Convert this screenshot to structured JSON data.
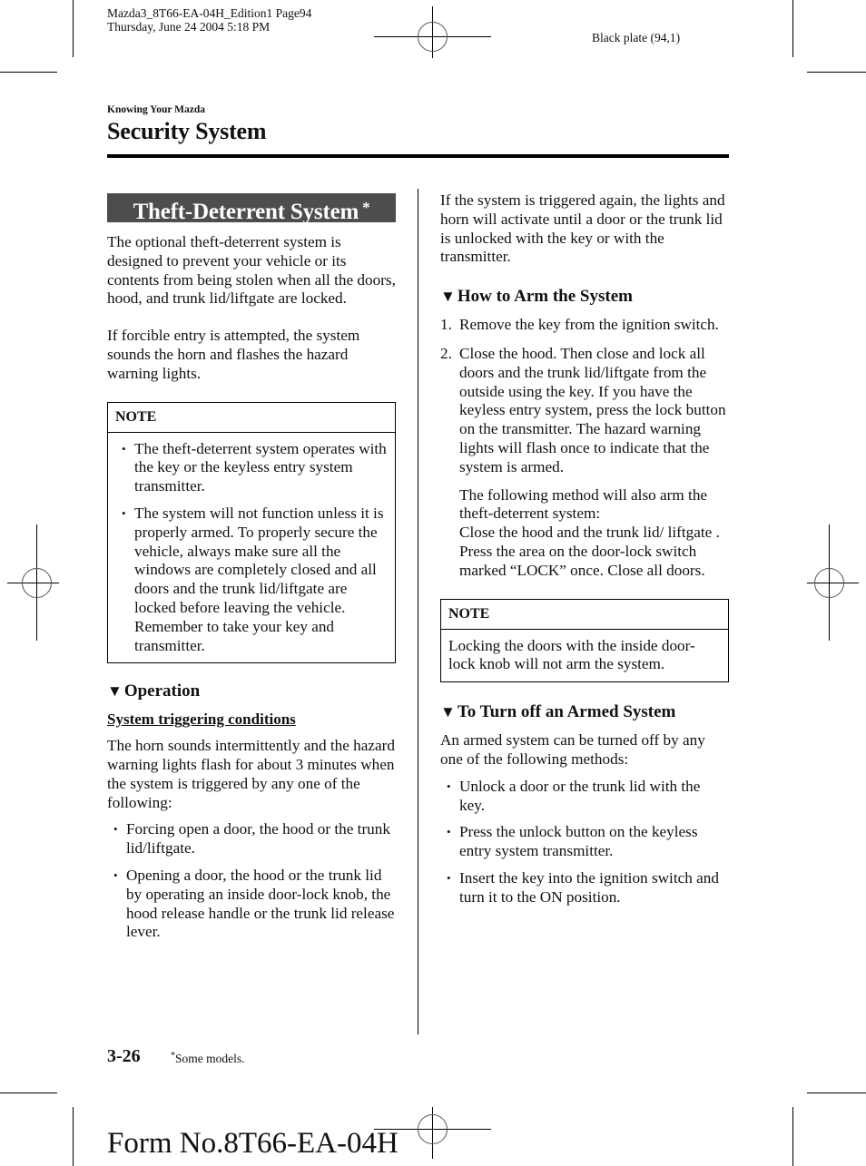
{
  "print_slug": {
    "line1": "Mazda3_8T66-EA-04H_Edition1 Page94",
    "line2": "Thursday, June 24 2004 5:18 PM",
    "plate": "Black plate (94,1)"
  },
  "header": {
    "chapter": "Knowing Your Mazda",
    "title": "Security System"
  },
  "left_column": {
    "section_title": "Theft-Deterrent System",
    "section_marker": "*",
    "intro_paragraphs": [
      "The optional theft-deterrent system is designed to prevent your vehicle or its contents from being stolen when all the doors, hood, and trunk lid/liftgate are locked.",
      "If forcible entry is attempted, the system sounds the horn and flashes the hazard warning lights."
    ],
    "note": {
      "heading": "NOTE",
      "bullet_glyph": "•",
      "items": [
        "The theft-deterrent system operates with the key or the keyless entry system transmitter.",
        "The system will not function unless it is properly armed. To properly secure the vehicle, always make sure all the windows are completely closed and all doors and the trunk lid/liftgate are locked before leaving the vehicle. Remember to take your key and transmitter."
      ]
    },
    "operation": {
      "heading_glyph": "▼",
      "heading": "Operation",
      "subheading": "System triggering conditions",
      "paragraph": "The horn sounds intermittently and the hazard warning lights flash for about 3 minutes when the system is triggered by any one of the following:",
      "bullet_glyph": "•",
      "items": [
        "Forcing open a door, the hood or the trunk lid/liftgate.",
        "Opening a door, the hood or the trunk lid by operating an inside door-lock knob, the hood release handle or the trunk lid release lever."
      ]
    }
  },
  "right_column": {
    "retrigger_paragraph": "If the system is triggered again, the lights and horn will activate until a door or the trunk lid is unlocked with the key or with the transmitter.",
    "arm": {
      "heading_glyph": "▼",
      "heading": "How to Arm the System",
      "steps": [
        {
          "num": "1.",
          "text": "Remove the key from the ignition switch."
        },
        {
          "num": "2.",
          "text": "Close the hood. Then close and lock all doors and the trunk lid/liftgate from the outside using the key. If you have the keyless entry system, press the lock button on the transmitter. The hazard warning lights will flash once to indicate that the system is armed."
        }
      ],
      "alt_method_intro": "The following method will also arm the theft-deterrent system:",
      "alt_method_text": "Close the hood and the trunk lid/ liftgate . Press the area on the door-lock switch marked “LOCK” once. Close all doors."
    },
    "note": {
      "heading": "NOTE",
      "text": "Locking the doors with the inside door-lock knob will not arm the system."
    },
    "turn_off": {
      "heading_glyph": "▼",
      "heading": "To Turn off an Armed System",
      "paragraph": "An armed system can be turned off by any one of the following methods:",
      "bullet_glyph": "•",
      "items": [
        "Unlock a door or the trunk lid with the key.",
        "Press the unlock button on the keyless entry system transmitter.",
        "Insert the key into the ignition switch and turn it to the ON position."
      ]
    }
  },
  "footer": {
    "page_number": "3-26",
    "footnote_marker": "*",
    "footnote_text": "Some models.",
    "form_number": "Form No.8T66-EA-04H"
  },
  "colors": {
    "title_bar_bg": "#4d4d4d",
    "title_bar_text": "#ffffff",
    "text": "#111111"
  }
}
